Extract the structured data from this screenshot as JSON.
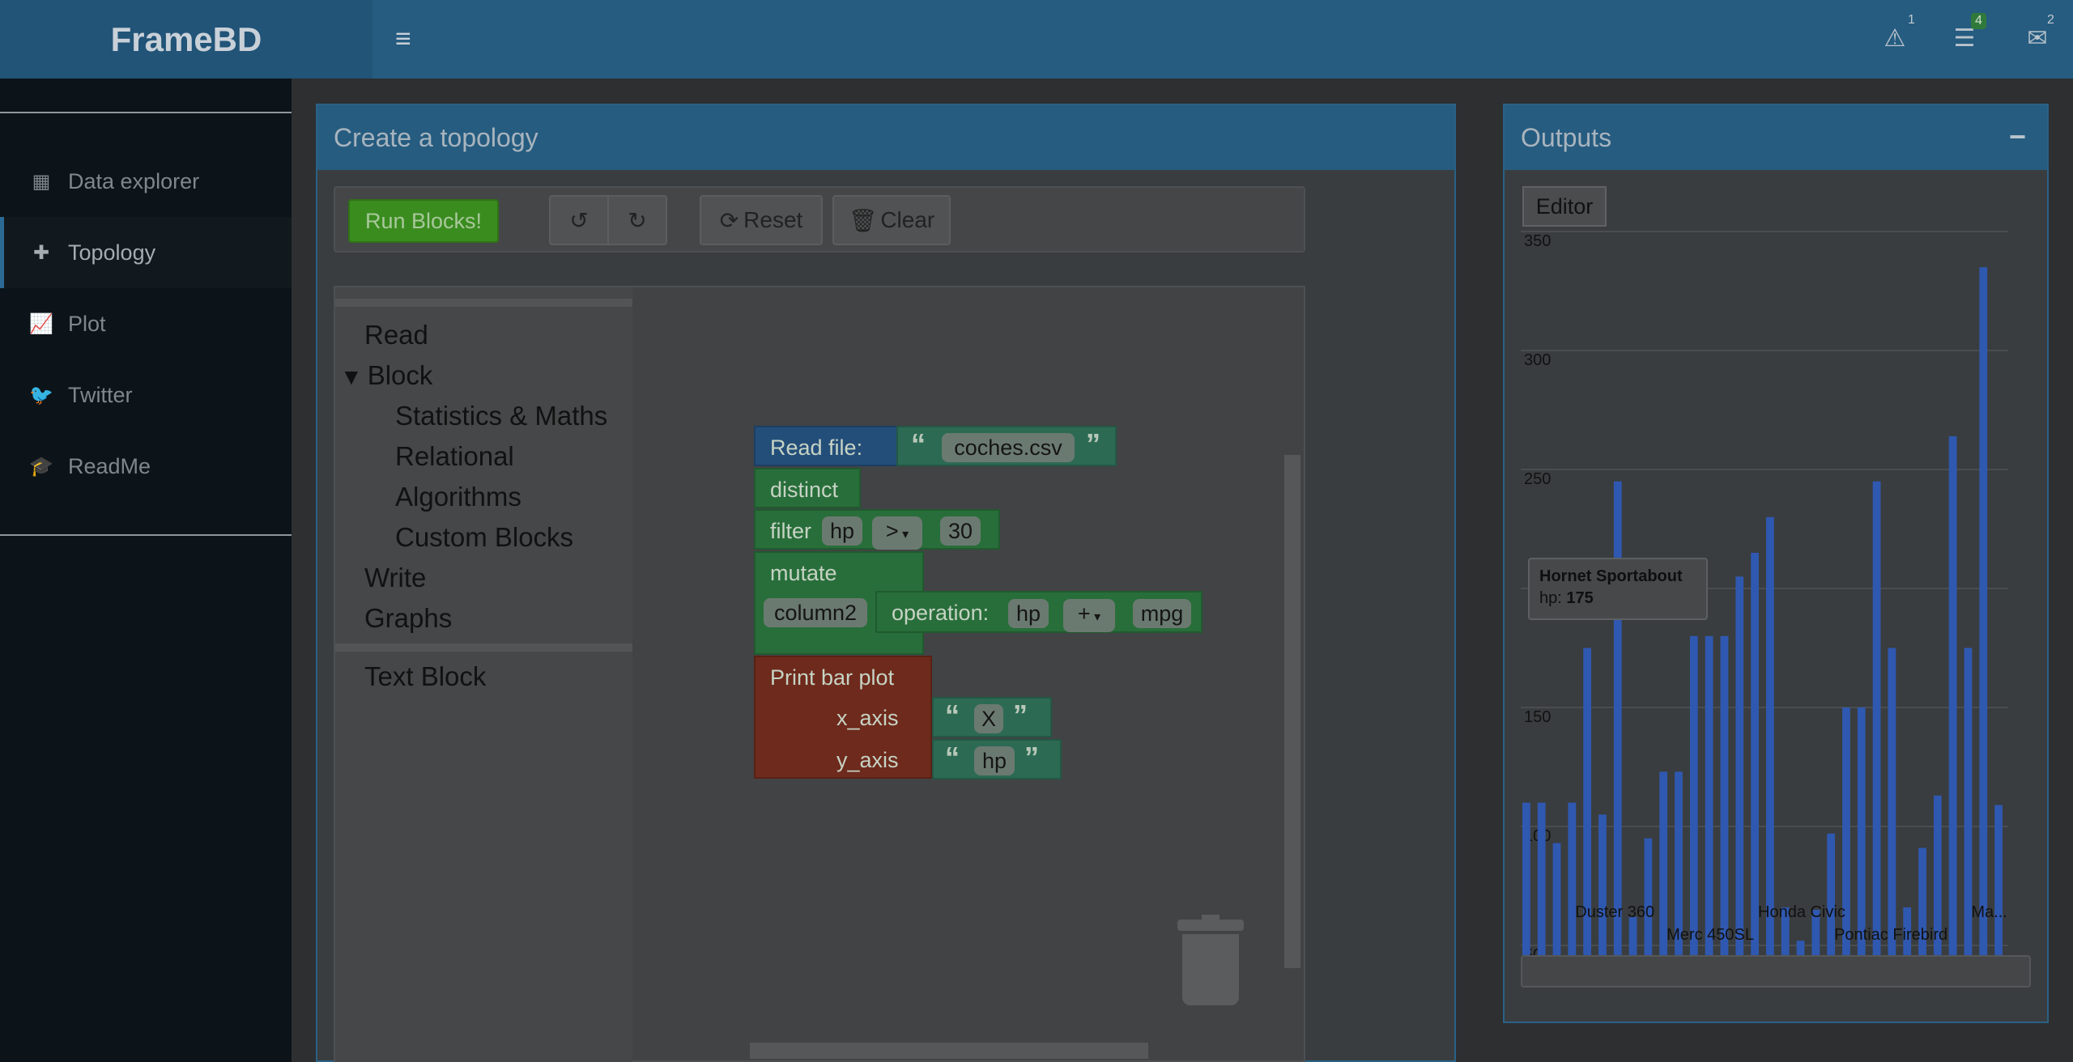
{
  "app": {
    "name": "FrameBD"
  },
  "header": {
    "alerts_count": "1",
    "tasks_count": "4",
    "messages_count": "2"
  },
  "sidebar": {
    "items": [
      {
        "label": "Data explorer",
        "icon": "table-icon"
      },
      {
        "label": "Topology",
        "icon": "puzzle-icon"
      },
      {
        "label": "Plot",
        "icon": "line-chart-icon"
      },
      {
        "label": "Twitter",
        "icon": "twitter-icon"
      },
      {
        "label": "ReadMe",
        "icon": "graduation-cap-icon"
      }
    ]
  },
  "topology": {
    "title": "Create a topology",
    "run_label": "Run Blocks!",
    "reset_label": "Reset",
    "clear_label": "Clear",
    "toolbox": {
      "read": "Read",
      "block": "Block",
      "stats": "Statistics & Maths",
      "relational": "Relational",
      "algorithms": "Algorithms",
      "custom": "Custom Blocks",
      "write": "Write",
      "graphs": "Graphs",
      "text_block": "Text Block"
    },
    "blocks": {
      "read_file": "Read file:",
      "file_name": "coches.csv",
      "distinct": "distinct",
      "filter": "filter",
      "filter_field": "hp",
      "filter_op": ">",
      "filter_value": "30",
      "mutate": "mutate",
      "mutate_column": "column2",
      "operation": "operation:",
      "op_left": "hp",
      "op_sign": "+",
      "op_right": "mpg",
      "print_bar": "Print bar plot",
      "x_axis": "x_axis",
      "x_value": "X",
      "y_axis": "y_axis",
      "y_value": "hp"
    }
  },
  "outputs": {
    "title": "Outputs",
    "minimize": "−",
    "editor_tab": "Editor",
    "tooltip": {
      "name": "Hornet Sportabout",
      "label": "hp:",
      "value": "175"
    }
  },
  "chart_data": {
    "type": "bar",
    "ylim": [
      50,
      350
    ],
    "yticks": [
      50,
      100,
      150,
      250,
      300,
      350
    ],
    "x_labels_visible": [
      "Duster 360",
      "Merc 450SL",
      "Honda Civic",
      "Pontiac Firebird",
      "Ma..."
    ],
    "values": [
      110,
      110,
      93,
      110,
      175,
      105,
      245,
      62,
      95,
      123,
      123,
      180,
      180,
      180,
      205,
      215,
      230,
      66,
      52,
      65,
      97,
      150,
      150,
      245,
      175,
      66,
      91,
      113,
      264,
      175,
      335,
      109
    ],
    "color": "#2f58b0",
    "grid": true
  }
}
